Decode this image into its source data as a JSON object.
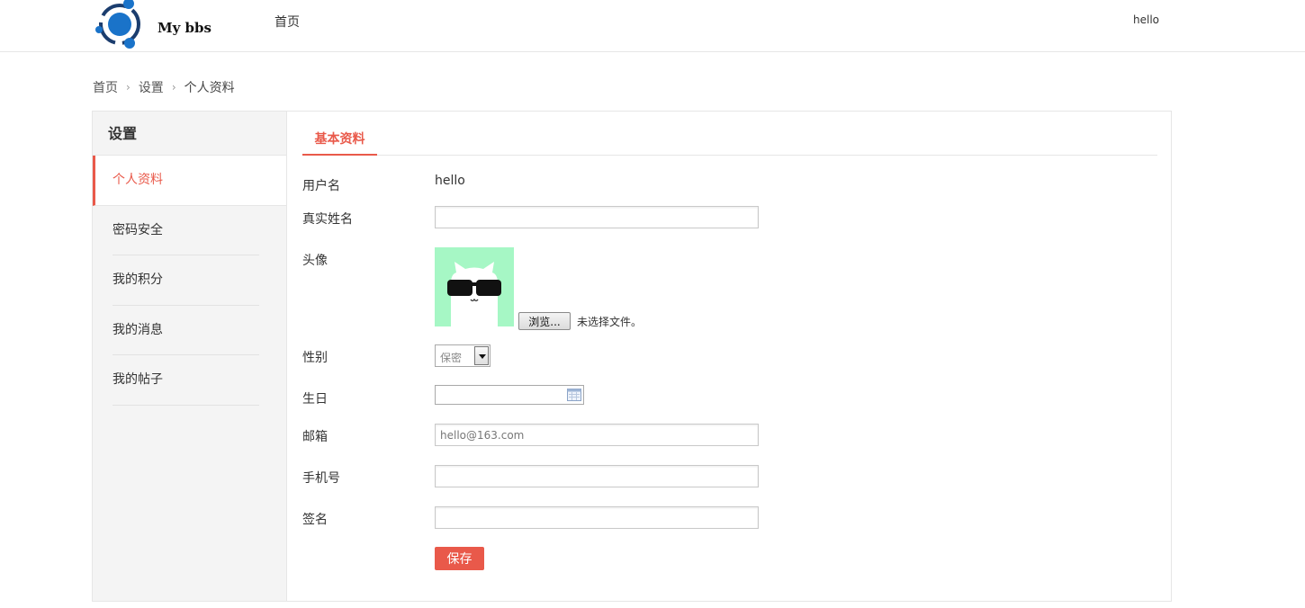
{
  "header": {
    "brand": "My bbs",
    "nav_home": "首页",
    "username": "hello"
  },
  "breadcrumb": {
    "items": [
      "首页",
      "设置",
      "个人资料"
    ]
  },
  "sidebar": {
    "title": "设置",
    "items": [
      {
        "label": "个人资料",
        "active": true
      },
      {
        "label": "密码安全",
        "active": false
      },
      {
        "label": "我的积分",
        "active": false
      },
      {
        "label": "我的消息",
        "active": false
      },
      {
        "label": "我的帖子",
        "active": false
      }
    ]
  },
  "tabs": {
    "active": "基本资料"
  },
  "form": {
    "username_label": "用户名",
    "username_value": "hello",
    "realname_label": "真实姓名",
    "realname_value": "",
    "avatar_label": "头像",
    "browse_label": "浏览...",
    "file_status": "未选择文件。",
    "gender_label": "性别",
    "gender_value": "保密",
    "birthday_label": "生日",
    "birthday_value": "",
    "email_label": "邮箱",
    "email_value": "hello@163.com",
    "phone_label": "手机号",
    "phone_value": "",
    "signature_label": "签名",
    "signature_value": "",
    "save_label": "保存"
  },
  "colors": {
    "accent": "#e9594a",
    "logo_blue": "#1a73c9",
    "avatar_bg": "#a6f7c5"
  }
}
